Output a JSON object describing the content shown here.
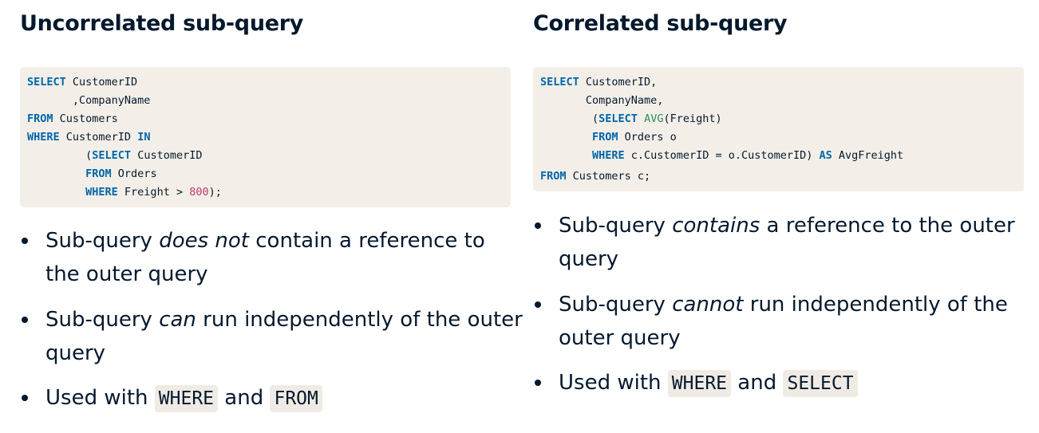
{
  "left": {
    "heading": "Uncorrelated sub-query",
    "code": [
      [
        {
          "t": "SELECT",
          "c": "kw"
        },
        {
          "t": " CustomerID"
        }
      ],
      [
        {
          "t": "       ,CompanyName"
        }
      ],
      [
        {
          "t": "FROM",
          "c": "kw"
        },
        {
          "t": " Customers"
        }
      ],
      [
        {
          "t": "WHERE",
          "c": "kw"
        },
        {
          "t": " CustomerID "
        },
        {
          "t": "IN",
          "c": "kw"
        }
      ],
      [
        {
          "t": "         ("
        },
        {
          "t": "SELECT",
          "c": "kw"
        },
        {
          "t": " CustomerID"
        }
      ],
      [
        {
          "t": "         "
        },
        {
          "t": "FROM",
          "c": "kw"
        },
        {
          "t": " Orders"
        }
      ],
      [
        {
          "t": "         "
        },
        {
          "t": "WHERE",
          "c": "kw"
        },
        {
          "t": " Freight > "
        },
        {
          "t": "800",
          "c": "num"
        },
        {
          "t": ");"
        }
      ]
    ],
    "bullets": [
      {
        "parts": [
          {
            "t": "Sub-query "
          },
          {
            "t": "does not",
            "s": "em"
          },
          {
            "t": " contain a reference to the outer query"
          }
        ]
      },
      {
        "parts": [
          {
            "t": "Sub-query "
          },
          {
            "t": "can",
            "s": "em"
          },
          {
            "t": " run independently of the outer query"
          }
        ]
      },
      {
        "parts": [
          {
            "t": "Used with "
          },
          {
            "t": "WHERE",
            "s": "kbd"
          },
          {
            "t": " and "
          },
          {
            "t": "FROM",
            "s": "kbd"
          }
        ]
      }
    ]
  },
  "right": {
    "heading": "Correlated sub-query",
    "code": [
      [
        {
          "t": "SELECT",
          "c": "kw"
        },
        {
          "t": " CustomerID,"
        }
      ],
      [
        {
          "t": "       CompanyName,"
        }
      ],
      [
        {
          "t": "        ("
        },
        {
          "t": "SELECT",
          "c": "kw"
        },
        {
          "t": " "
        },
        {
          "t": "AVG",
          "c": "fn"
        },
        {
          "t": "(Freight)"
        }
      ],
      [
        {
          "t": "        "
        },
        {
          "t": "FROM",
          "c": "kw"
        },
        {
          "t": " Orders o"
        }
      ],
      [
        {
          "t": "        "
        },
        {
          "t": "WHERE",
          "c": "kw"
        },
        {
          "t": " c.CustomerID = o.CustomerID) "
        },
        {
          "t": "AS",
          "c": "kw"
        },
        {
          "t": " AvgFreight"
        }
      ],
      [
        {
          "t": "FROM",
          "c": "kw"
        },
        {
          "t": " Customers c;"
        }
      ]
    ],
    "bullets": [
      {
        "parts": [
          {
            "t": "Sub-query "
          },
          {
            "t": "contains",
            "s": "em"
          },
          {
            "t": " a reference to the outer query"
          }
        ]
      },
      {
        "parts": [
          {
            "t": "Sub-query "
          },
          {
            "t": "cannot",
            "s": "em"
          },
          {
            "t": " run independently of the outer query"
          }
        ]
      },
      {
        "parts": [
          {
            "t": "Used with "
          },
          {
            "t": "WHERE",
            "s": "kbd"
          },
          {
            "t": " and "
          },
          {
            "t": "SELECT",
            "s": "kbd"
          }
        ]
      }
    ]
  }
}
